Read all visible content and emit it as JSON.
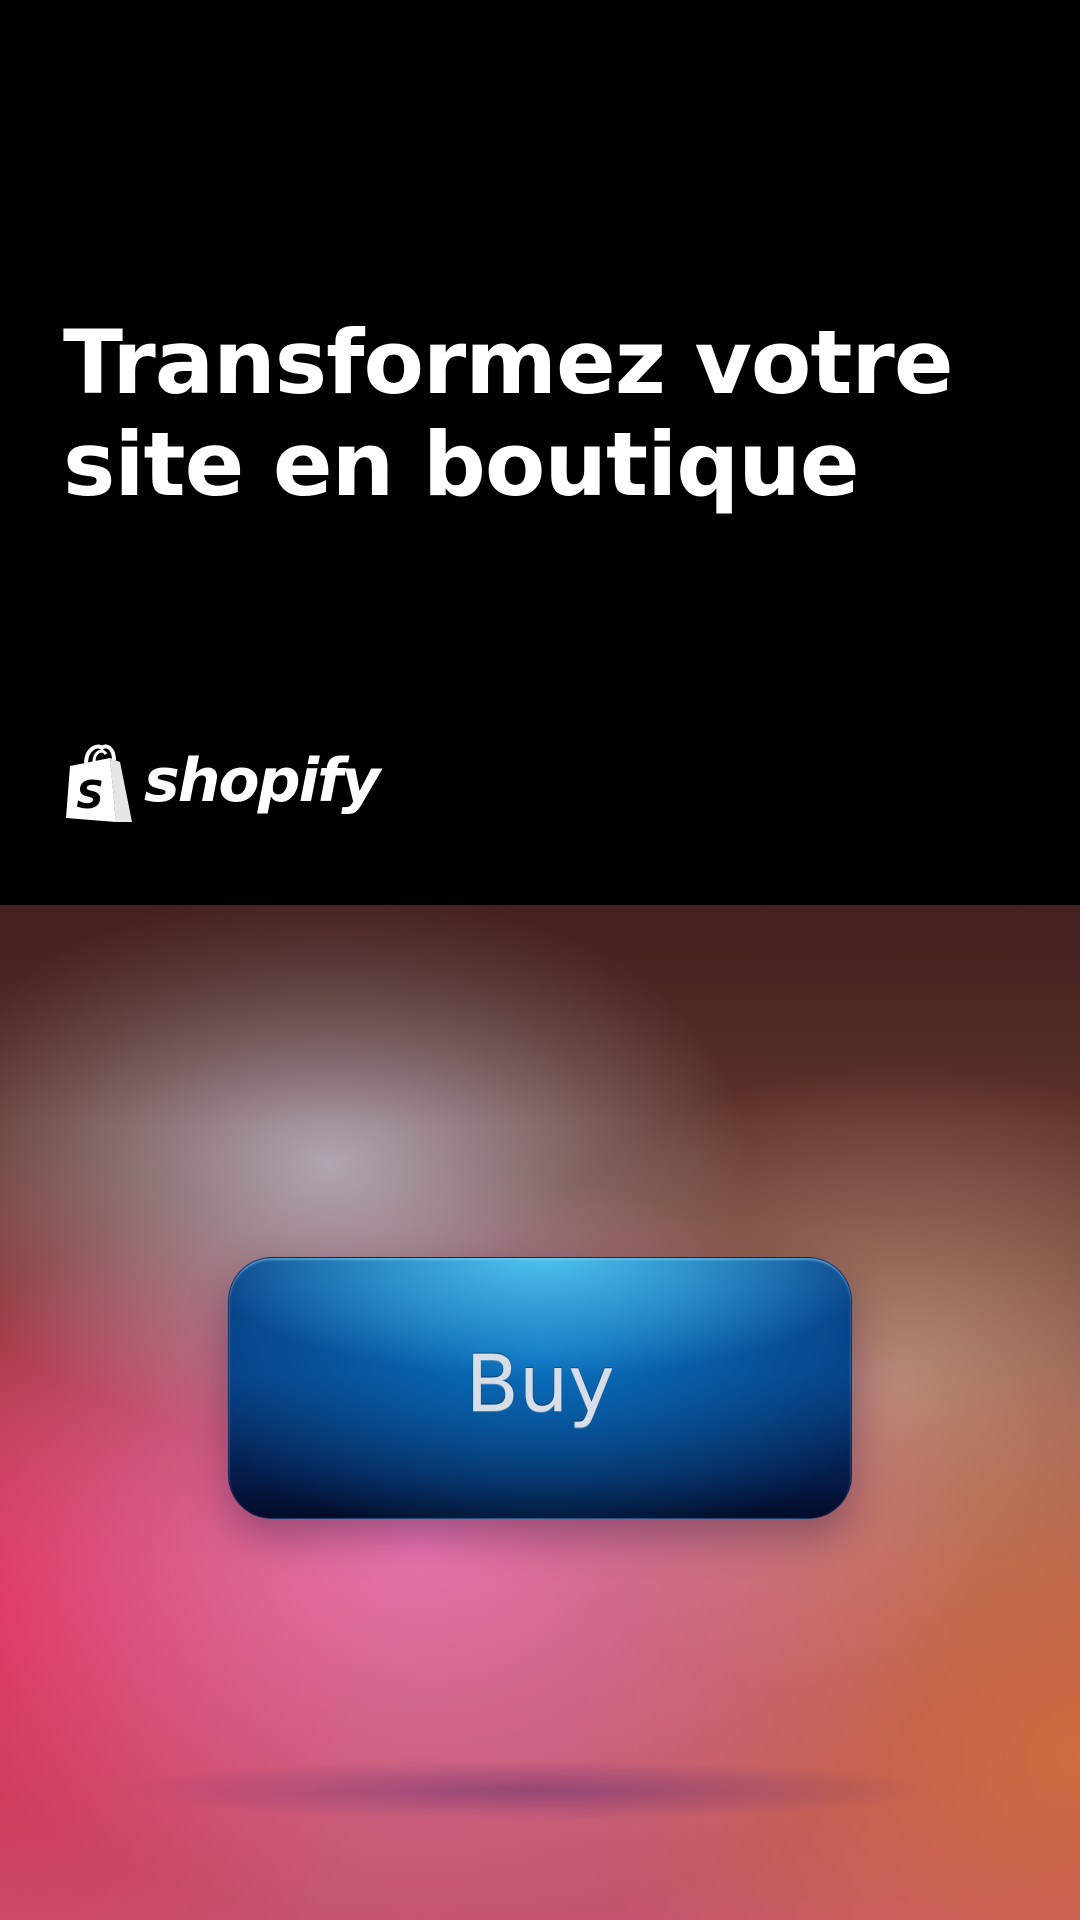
{
  "ad": {
    "headline_line1": "Transformez votre",
    "headline_line2": "site en boutique",
    "brand": {
      "name": "shopify",
      "logo_letter": "S",
      "icon": "shopping-bag-icon"
    }
  },
  "hero": {
    "button_label": "Buy"
  },
  "colors": {
    "top_background": "#000000",
    "headline_text": "#ffffff",
    "button_blue": "#063a7c"
  }
}
